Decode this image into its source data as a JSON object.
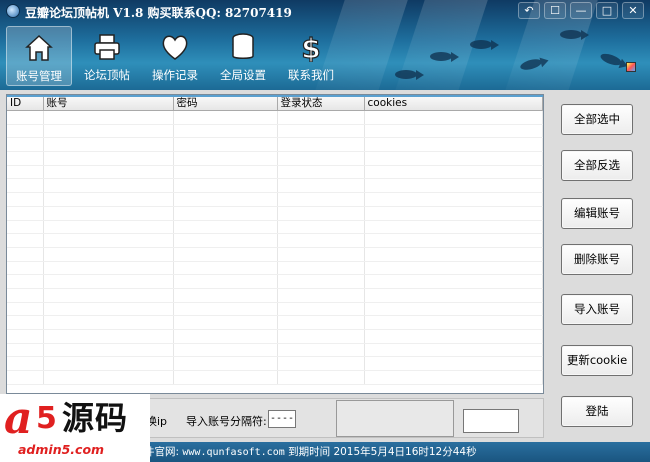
{
  "window": {
    "title": "豆瓣论坛顶帖机 V1.8 购买联系QQ: 82707419",
    "controls": [
      "↶",
      "☐",
      "—",
      "□",
      "✕"
    ]
  },
  "toolbar": [
    {
      "label": "账号管理",
      "icon": "home-icon"
    },
    {
      "label": "论坛顶帖",
      "icon": "printer-icon"
    },
    {
      "label": "操作记录",
      "icon": "heart-icon"
    },
    {
      "label": "全局设置",
      "icon": "database-icon"
    },
    {
      "label": "联系我们",
      "icon": "dollar-icon"
    }
  ],
  "table": {
    "columns": [
      "ID",
      "账号",
      "密码",
      "登录状态",
      "cookies"
    ],
    "row_count": 20
  },
  "side_buttons": [
    "全部选中",
    "全部反选",
    "编辑账号",
    "删除账号",
    "导入账号",
    "更新cookie",
    "登陆"
  ],
  "bottom": {
    "ip_label": "换ip",
    "separator_label": "导入账号分隔符:",
    "separator_value": "----"
  },
  "status": {
    "prefix": "件官网:",
    "url": "www.qunfasoft.com",
    "expiry_label": "到期时间",
    "expiry": "2015年5月4日16时12分44秒"
  },
  "watermark": {
    "brand": "a5源码",
    "url": "admin5.com"
  },
  "colors": {
    "accent": "#1e6f9e",
    "watermark_red": "#e02020"
  }
}
